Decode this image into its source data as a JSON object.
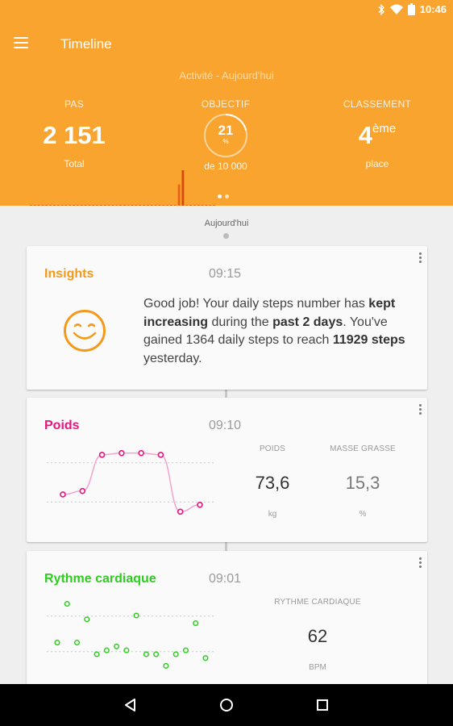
{
  "status_bar": {
    "time": "10:46",
    "icons": [
      "bluetooth-icon",
      "wifi-icon",
      "battery-icon"
    ]
  },
  "app_bar": {
    "title": "Timeline",
    "menu_icon": "menu-icon"
  },
  "activity": {
    "subtitle": "Activité - Aujourd'hui",
    "steps": {
      "label": "PAS",
      "value": "2 151",
      "sub": "Total"
    },
    "goal": {
      "label": "OBJECTIF",
      "percent": "21",
      "percent_sign": "%",
      "percent_value": 21,
      "sub": "de 10 000"
    },
    "rank": {
      "label": "CLASSEMENT",
      "value": "4",
      "suffix": "ème",
      "sub": "place"
    },
    "pager": {
      "pages": 2,
      "active": 0
    }
  },
  "timeline": {
    "date_label": "Aujourd'hui"
  },
  "cards": {
    "insights": {
      "title": "Insights",
      "time": "09:15",
      "icon": "smiley-icon",
      "text_parts": [
        {
          "t": "Good job! Your daily steps number has ",
          "b": false
        },
        {
          "t": "kept increasing",
          "b": true
        },
        {
          "t": " during the ",
          "b": false
        },
        {
          "t": "past 2 days",
          "b": true
        },
        {
          "t": ". You've gained 1364 daily steps to reach ",
          "b": false
        },
        {
          "t": "11929 steps",
          "b": true
        },
        {
          "t": " yesterday.",
          "b": false
        }
      ]
    },
    "poids": {
      "title": "Poids",
      "time": "09:10",
      "weight": {
        "label": "POIDS",
        "value": "73,6",
        "unit": "kg"
      },
      "fat": {
        "label": "MASSE GRASSE",
        "value": "15,3",
        "unit": "%"
      }
    },
    "rythme": {
      "title": "Rythme cardiaque",
      "time": "09:01",
      "heart_rate": {
        "label": "RYTHME CARDIAQUE",
        "value": "62",
        "unit": "BPM"
      }
    }
  },
  "nav_bar": {
    "buttons": [
      "back-icon",
      "home-icon",
      "recents-icon"
    ]
  },
  "colors": {
    "header": "#f9a42e",
    "steps_bar": "#e8621a",
    "steps_bar_dark": "#d9480f",
    "insights": "#f39a1a",
    "poids": "#e6167d",
    "poids_line": "#f4a3cf",
    "rythme": "#2ecc1f"
  },
  "chart_data": [
    {
      "type": "bar",
      "id": "steps-sparkline",
      "values": [
        40,
        40,
        40,
        40,
        40,
        40,
        40,
        40,
        40,
        40,
        40,
        40,
        40,
        40,
        40,
        40,
        40,
        40,
        40,
        40,
        40,
        40,
        40,
        40,
        40,
        40,
        40,
        40,
        40,
        40,
        40,
        40,
        40,
        40,
        40,
        40,
        40,
        40,
        620,
        1020,
        40,
        40,
        40,
        40,
        40,
        40,
        40,
        40
      ]
    },
    {
      "type": "line",
      "id": "weight-trend",
      "values": [
        74.2,
        74.4,
        76.5,
        76.6,
        76.6,
        76.5,
        73.2,
        73.6
      ]
    },
    {
      "type": "scatter",
      "id": "heart-rate-points",
      "values": [
        66,
        76,
        66,
        72,
        63,
        64,
        65,
        64,
        73,
        63,
        63,
        60,
        63,
        64,
        71,
        62
      ]
    }
  ]
}
